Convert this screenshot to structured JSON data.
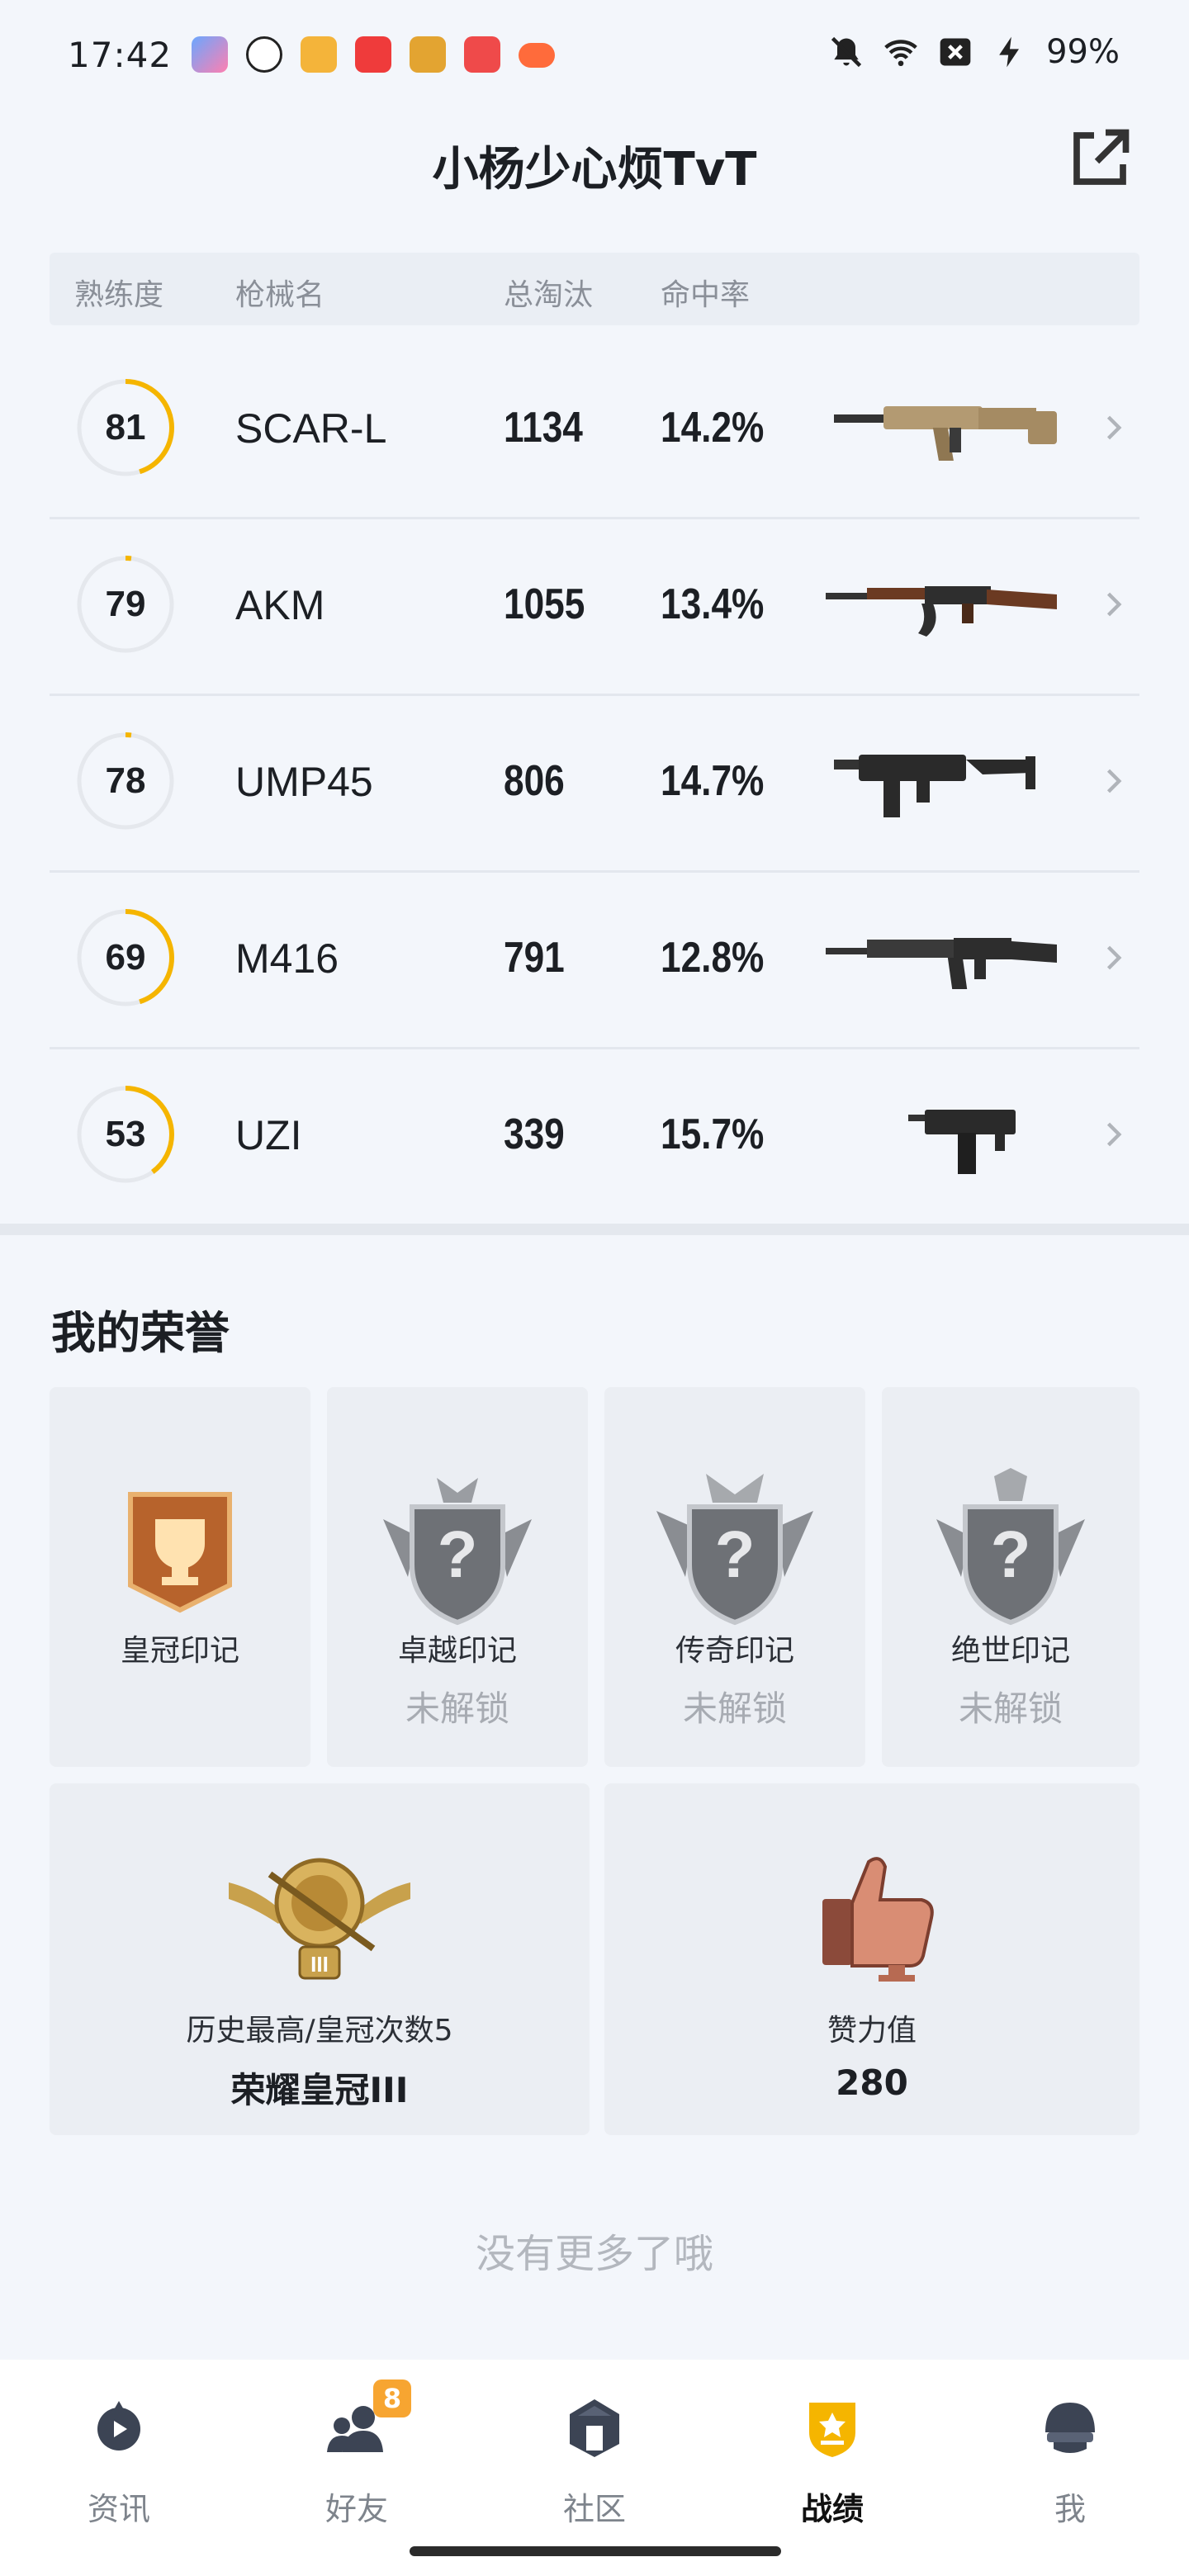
{
  "status_bar": {
    "time": "17:42",
    "battery": "99%",
    "icons": [
      "game-app-icon",
      "wechat-icon",
      "notes-app-icon",
      "music-app-icon",
      "game-center-icon",
      "video-app-icon",
      "gamepad-icon",
      "bell-muted-icon",
      "wifi-icon",
      "close-box-icon",
      "charging-icon"
    ]
  },
  "header": {
    "title": "小杨少心烦TvT",
    "share_icon": "share-icon"
  },
  "weapon_table": {
    "columns": [
      "熟练度",
      "枪械名",
      "总淘汰",
      "命中率"
    ],
    "rows": [
      {
        "proficiency": "81",
        "name": "SCAR-L",
        "kills": "1134",
        "accuracy": "14.2%",
        "ring_fraction": 0.45
      },
      {
        "proficiency": "79",
        "name": "AKM",
        "kills": "1055",
        "accuracy": "13.4%",
        "ring_fraction": 0.02
      },
      {
        "proficiency": "78",
        "name": "UMP45",
        "kills": "806",
        "accuracy": "14.7%",
        "ring_fraction": 0.02
      },
      {
        "proficiency": "69",
        "name": "M416",
        "kills": "791",
        "accuracy": "12.8%",
        "ring_fraction": 0.45
      },
      {
        "proficiency": "53",
        "name": "UZI",
        "kills": "339",
        "accuracy": "15.7%",
        "ring_fraction": 0.4
      }
    ]
  },
  "honor": {
    "title": "我的荣誉",
    "badges": [
      {
        "name": "皇冠印记",
        "status": ""
      },
      {
        "name": "卓越印记",
        "status": "未解锁"
      },
      {
        "name": "传奇印记",
        "status": "未解锁"
      },
      {
        "name": "绝世印记",
        "status": "未解锁"
      }
    ],
    "highest": {
      "label": "历史最高/皇冠次数5",
      "value": "荣耀皇冠III"
    },
    "likes": {
      "label": "赞力值",
      "value": "280"
    }
  },
  "footer_text": "没有更多了哦",
  "bottom_nav": {
    "items": [
      {
        "label": "资讯",
        "icon": "news-icon"
      },
      {
        "label": "好友",
        "icon": "friends-icon",
        "badge": "8"
      },
      {
        "label": "社区",
        "icon": "community-icon"
      },
      {
        "label": "战绩",
        "icon": "record-icon",
        "active": true
      },
      {
        "label": "我",
        "icon": "helmet-icon"
      }
    ]
  },
  "colors": {
    "ring_accent": "#f5b500",
    "nav_badge": "#f7a531",
    "active_icon": "#f5b500"
  }
}
